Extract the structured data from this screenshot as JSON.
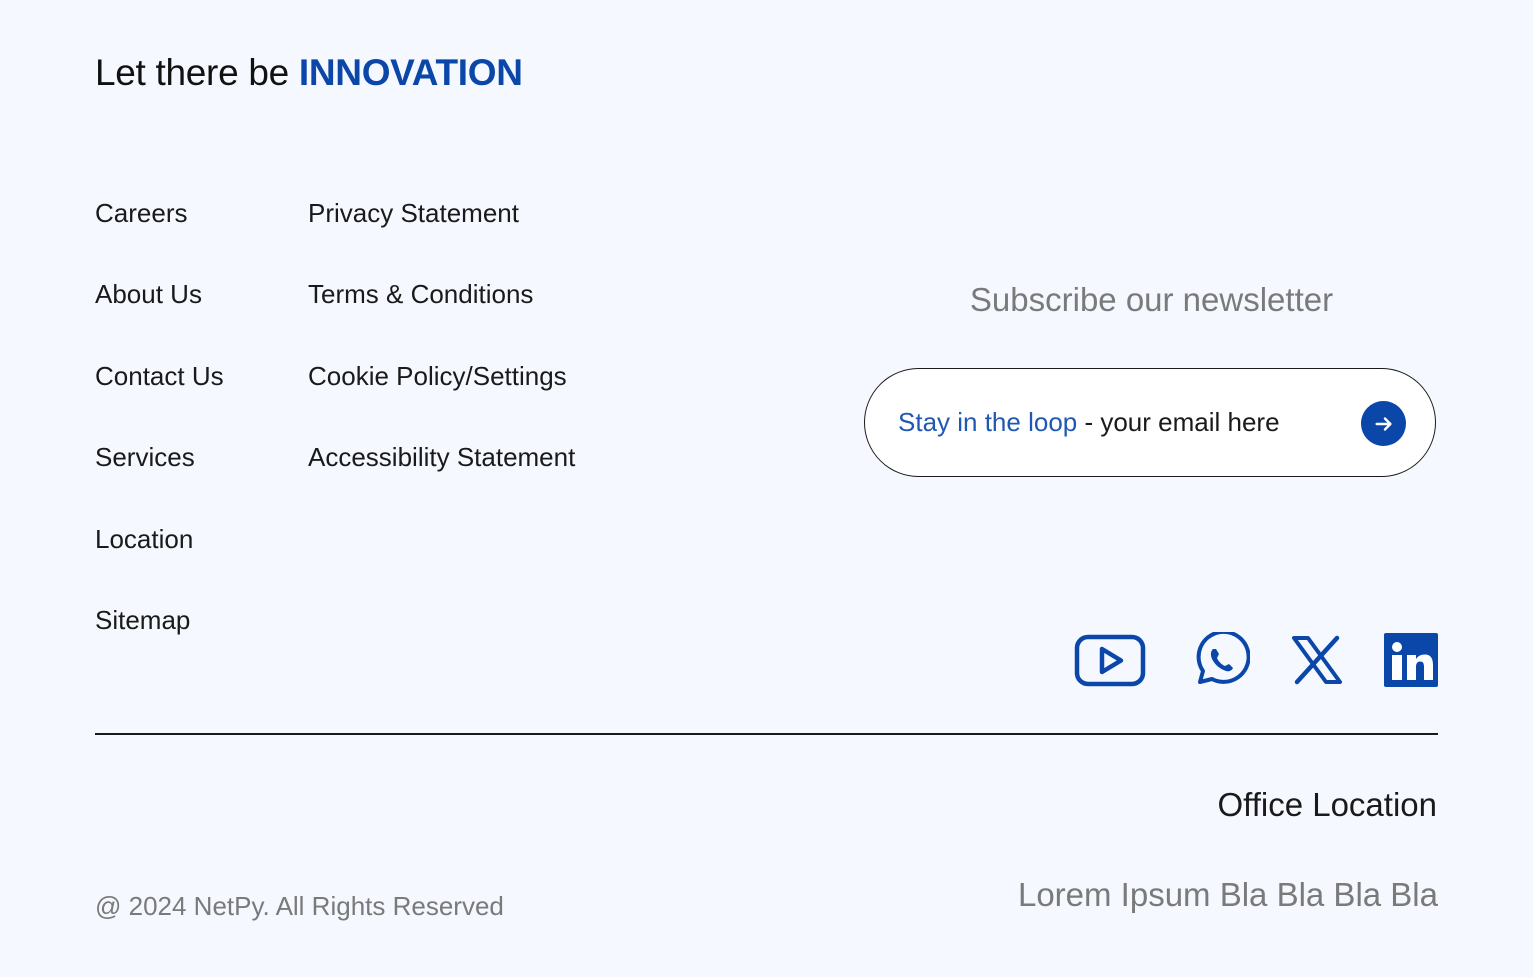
{
  "tagline": {
    "prefix": "Let there be ",
    "accent": "INNOVATION"
  },
  "links": {
    "col1": [
      "Careers",
      "About Us",
      "Contact Us",
      "Services",
      "Location",
      "Sitemap"
    ],
    "col2": [
      "Privacy Statement",
      "Terms & Conditions",
      "Cookie Policy/Settings",
      "Accessibility Statement"
    ]
  },
  "newsletter": {
    "title": "Subscribe our newsletter",
    "placeholder_accent": "Stay in the loop",
    "placeholder_rest": " - your email here",
    "submit_icon": "arrow-right-icon"
  },
  "social": {
    "icons": [
      "youtube-icon",
      "whatsapp-icon",
      "x-icon",
      "linkedin-icon"
    ]
  },
  "office": {
    "title": "Office Location",
    "address": "Lorem Ipsum Bla Bla Bla Bla"
  },
  "footer": {
    "copyright": "@ 2024 NetPy. All Rights Reserved"
  },
  "colors": {
    "accent": "#0b47a8",
    "background": "#f5f8ff",
    "text": "#1a1a1a",
    "muted": "#7a7a7a"
  }
}
